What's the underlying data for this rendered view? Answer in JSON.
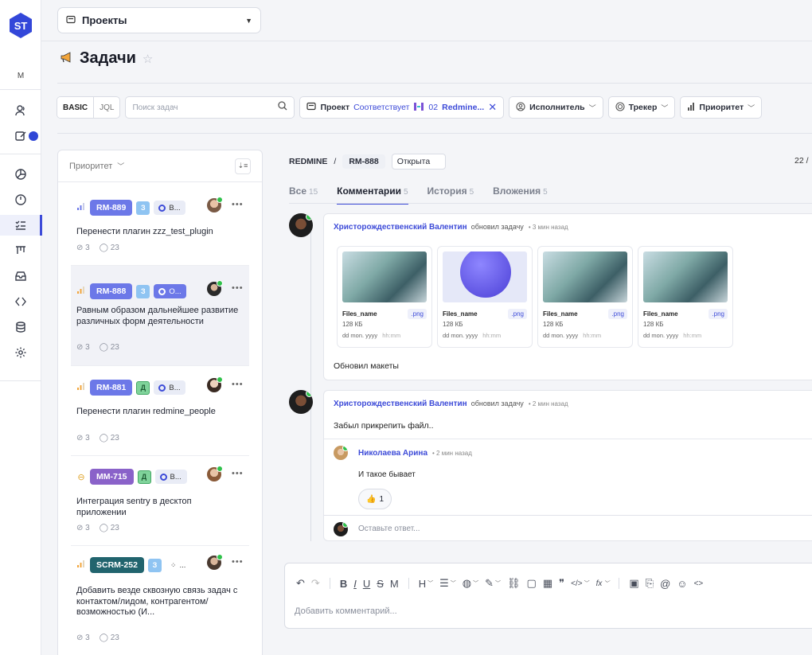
{
  "sidebar": {
    "logo_text": "ST",
    "workspace_letter": "M",
    "icons": [
      "users-icon",
      "edit-icon",
      "chart-pie-icon",
      "clock-icon",
      "tasks-icon",
      "board-icon",
      "inbox-icon",
      "code-icon",
      "database-icon",
      "settings-icon"
    ],
    "active": "tasks-icon"
  },
  "topbar": {
    "project_select": "Проекты"
  },
  "page": {
    "title": "Задачи"
  },
  "filters": {
    "mode_basic": "BASIC",
    "mode_jql": "JQL",
    "search_placeholder": "Поиск задач",
    "project_label": "Проект",
    "project_op": "Соответствует",
    "project_count": "02",
    "project_value": "Redmine...",
    "assignee": "Исполнитель",
    "tracker": "Трекер",
    "priority": "Приоритет"
  },
  "list": {
    "sort_label": "Приоритет",
    "items": [
      {
        "key": "RM-889",
        "key_color": "#6c78e8",
        "type": "З",
        "status": "В...",
        "title": "Перенести плагин zzz_test_plugin",
        "attachments": "3",
        "comments": "23"
      },
      {
        "key": "RM-888",
        "key_color": "#6c78e8",
        "type": "З",
        "status": "О...",
        "title": "Равным образом дальнейшее развитие различных форм деятельности",
        "attachments": "3",
        "comments": "23"
      },
      {
        "key": "RM-881",
        "key_color": "#6c78e8",
        "type": "Д",
        "status": "В...",
        "title": "Перенести плагин redmine_people",
        "attachments": "3",
        "comments": "23"
      },
      {
        "key": "MM-715",
        "key_color": "#8a62c9",
        "type": "Д",
        "status": "В...",
        "title": "Интеграция sentry в десктоп приложении",
        "attachments": "3",
        "comments": "23"
      },
      {
        "key": "SCRM-252",
        "key_color": "#21646e",
        "type": "З",
        "status": "...",
        "title": "Добавить везде сквозную связь задач с контактом/лидом, контрагентом/возможностью (И...",
        "attachments": "3",
        "comments": "23"
      }
    ]
  },
  "detail": {
    "project": "REDMINE",
    "sep": "/",
    "key": "RM-888",
    "status": "Открыта",
    "counter": "22 /",
    "tabs": [
      {
        "label": "Все",
        "count": "15"
      },
      {
        "label": "Комментарии",
        "count": "5"
      },
      {
        "label": "История",
        "count": "5"
      },
      {
        "label": "Вложения",
        "count": "5"
      }
    ],
    "comments": [
      {
        "author": "Христорождественский Валентин",
        "action": "обновил задачу",
        "time": "• 3 мин назад",
        "files": [
          {
            "name": "Files_name",
            "ext": ".png",
            "size": "128 КБ",
            "date": "dd mon. yyyy",
            "hm": "hh:mm"
          },
          {
            "name": "Files_name",
            "ext": ".png",
            "size": "128 КБ",
            "date": "dd mon. yyyy",
            "hm": "hh:mm"
          },
          {
            "name": "Files_name",
            "ext": ".png",
            "size": "128 КБ",
            "date": "dd mon. yyyy",
            "hm": "hh:mm"
          },
          {
            "name": "Files_name",
            "ext": ".png",
            "size": "128 КБ",
            "date": "dd mon. yyyy",
            "hm": "hh:mm"
          }
        ],
        "text": "Обновил макеты"
      },
      {
        "author": "Христорождественский Валентин",
        "action": "обновил задачу",
        "time": "• 2 мин назад",
        "text": "Забыл прикрепить файл..",
        "reply": {
          "author": "Николаева Арина",
          "time": "• 2 мин назад",
          "text": "И такое бывает",
          "reaction_emoji": "👍",
          "reaction_count": "1"
        },
        "reply_placeholder": "Оставьте ответ..."
      }
    ]
  },
  "editor": {
    "placeholder": "Добавить комментарий..."
  }
}
